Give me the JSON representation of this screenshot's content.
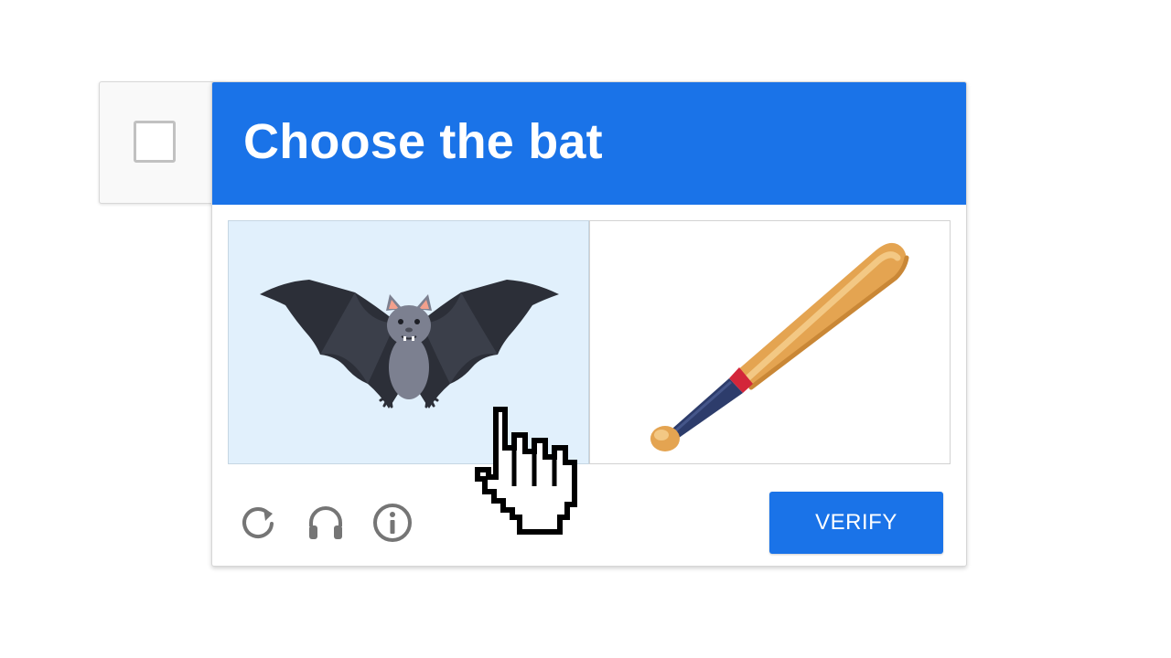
{
  "checkbox": {
    "checked": false
  },
  "challenge": {
    "title": "Choose the bat",
    "accent_color": "#1a73e8",
    "tiles": [
      {
        "name": "bat animal",
        "selected": true,
        "background": "#e1f0fc"
      },
      {
        "name": "baseball bat",
        "selected": false,
        "background": "#ffffff"
      }
    ],
    "toolbar": {
      "icons": [
        "reload-icon",
        "headphones-icon",
        "info-icon"
      ]
    },
    "verify_label": "VERIFY"
  },
  "cursor": {
    "icon": "pointing-hand-cursor-icon"
  }
}
